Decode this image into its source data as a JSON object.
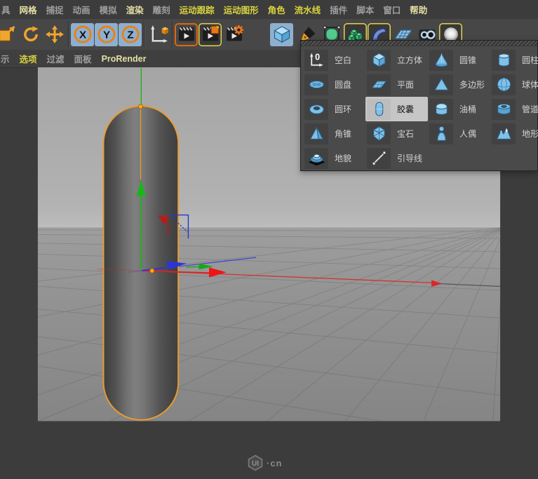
{
  "colors": {
    "menu-yellow": "#d9d33f",
    "menu-pale": "#e6e0a4",
    "accent-orange": "#f09b2c",
    "selection-outline": "#ed9b2d",
    "axis-red": "#dd2222",
    "axis-green": "#1db31d",
    "axis-blue": "#2a35d8",
    "icon-blue": "#7fc1e8",
    "active-button-bg": "#8fafd0",
    "panel-bg": "#4a4a4a",
    "highlight-bg": "#c6c6c6"
  },
  "menubar": {
    "items": [
      {
        "label": "具",
        "tone": "gray"
      },
      {
        "label": "网格",
        "tone": "pale"
      },
      {
        "label": "捕捉",
        "tone": "gray"
      },
      {
        "label": "动画",
        "tone": "gray"
      },
      {
        "label": "模拟",
        "tone": "gray"
      },
      {
        "label": "渲染",
        "tone": "pale"
      },
      {
        "label": "雕刻",
        "tone": "gray"
      },
      {
        "label": "运动跟踪",
        "tone": "yellow"
      },
      {
        "label": "运动图形",
        "tone": "yellow"
      },
      {
        "label": "角色",
        "tone": "yellow"
      },
      {
        "label": "流水线",
        "tone": "yellow"
      },
      {
        "label": "插件",
        "tone": "gray"
      },
      {
        "label": "脚本",
        "tone": "gray"
      },
      {
        "label": "窗口",
        "tone": "gray"
      },
      {
        "label": "帮助",
        "tone": "pale"
      }
    ]
  },
  "toolbar": {
    "buttons": [
      {
        "name": "scale-tool",
        "icon": "scale-icon",
        "group_start": false,
        "partial": true
      },
      {
        "name": "rotate-tool",
        "icon": "rotate-icon"
      },
      {
        "name": "move-tool",
        "icon": "move-icon"
      },
      {
        "name": "lock-x-axis",
        "icon": "axis-x-icon",
        "letter": "X",
        "active": true,
        "group_start": true
      },
      {
        "name": "lock-y-axis",
        "icon": "axis-y-icon",
        "letter": "Y",
        "active": true
      },
      {
        "name": "lock-z-axis",
        "icon": "axis-z-icon",
        "letter": "Z",
        "active": true
      },
      {
        "name": "coordinate-system",
        "icon": "coordinate-icon",
        "group_start": true
      },
      {
        "name": "render-view",
        "icon": "render-view-icon",
        "frame": "orange",
        "group_start": true
      },
      {
        "name": "render-picture-viewer",
        "icon": "render-picture-icon",
        "frame": "yellow"
      },
      {
        "name": "render-settings",
        "icon": "render-settings-icon"
      },
      {
        "name": "primitive-cube-dropdown",
        "icon": "cube-primitive-icon",
        "active": true,
        "gap_before": 34
      },
      {
        "name": "pen-spline-tool",
        "icon": "pen-icon",
        "gap_before": 3
      },
      {
        "name": "subdivision-surface",
        "icon": "subdivision-icon"
      },
      {
        "name": "array-generator",
        "icon": "array-icon",
        "frame": "yellow"
      },
      {
        "name": "bend-deformer",
        "icon": "bend-icon",
        "frame": "yellow"
      },
      {
        "name": "floor-object",
        "icon": "floor-icon"
      },
      {
        "name": "camera-object",
        "icon": "camera-icon"
      },
      {
        "name": "light-object",
        "icon": "light-icon",
        "frame": "yellow"
      }
    ]
  },
  "viewport_menu": {
    "items": [
      {
        "label": "示",
        "tone": "gray"
      },
      {
        "label": "选项",
        "tone": "yellow"
      },
      {
        "label": "过滤",
        "tone": "gray"
      },
      {
        "label": "面板",
        "tone": "gray"
      },
      {
        "label": "ProRender",
        "tone": "pale"
      }
    ]
  },
  "primitives_menu": {
    "items": [
      {
        "label": "空白",
        "icon": "null"
      },
      {
        "label": "立方体",
        "icon": "cube"
      },
      {
        "label": "圆锥",
        "icon": "cone"
      },
      {
        "label": "圆柱",
        "icon": "cylinder"
      },
      {
        "label": "圆盘",
        "icon": "disc"
      },
      {
        "label": "平面",
        "icon": "plane"
      },
      {
        "label": "多边形",
        "icon": "polygon"
      },
      {
        "label": "球体",
        "icon": "sphere"
      },
      {
        "label": "圆环",
        "icon": "torus"
      },
      {
        "label": "胶囊",
        "icon": "capsule",
        "selected": true
      },
      {
        "label": "油桶",
        "icon": "oiltank"
      },
      {
        "label": "管道",
        "icon": "tube"
      },
      {
        "label": "角锥",
        "icon": "pyramid"
      },
      {
        "label": "宝石",
        "icon": "platonic"
      },
      {
        "label": "人偶",
        "icon": "figure"
      },
      {
        "label": "地形",
        "icon": "landscape"
      },
      {
        "label": "地貌",
        "icon": "relief"
      },
      {
        "label": "引导线",
        "icon": "guide"
      }
    ]
  },
  "watermark": {
    "badge": "UI",
    "suffix": "·cn"
  }
}
